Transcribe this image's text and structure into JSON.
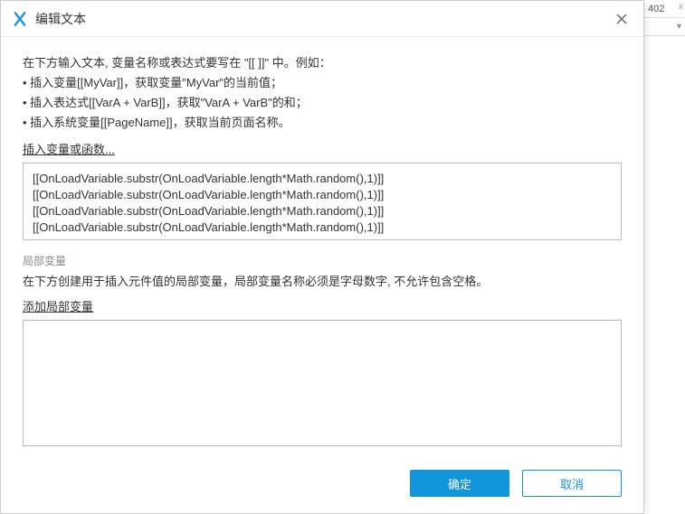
{
  "ruler": {
    "value": "402",
    "axis": "x"
  },
  "dialog": {
    "title": "编辑文本",
    "instructions": {
      "intro": "在下方输入文本, 变量名称或表达式要写在 \"[[ ]]\" 中。例如：",
      "line1": "• 插入变量[[MyVar]]，获取变量\"MyVar\"的当前值；",
      "line2": "• 插入表达式[[VarA + VarB]]，获取\"VarA + VarB\"的和；",
      "line3": "• 插入系统变量[[PageName]]，获取当前页面名称。"
    },
    "insert_var_link": "插入变量或函数...",
    "expression_lines": [
      "[[OnLoadVariable.substr(OnLoadVariable.length*Math.random(),1)]]",
      "[[OnLoadVariable.substr(OnLoadVariable.length*Math.random(),1)]]",
      "[[OnLoadVariable.substr(OnLoadVariable.length*Math.random(),1)]]",
      "[[OnLoadVariable.substr(OnLoadVariable.length*Math.random(),1)]]"
    ],
    "local_var_section_label": "局部变量",
    "local_var_desc": "在下方创建用于插入元件值的局部变量，局部变量名称必须是字母数字, 不允许包含空格。",
    "add_local_var_link": "添加局部变量",
    "buttons": {
      "ok": "确定",
      "cancel": "取消"
    }
  }
}
